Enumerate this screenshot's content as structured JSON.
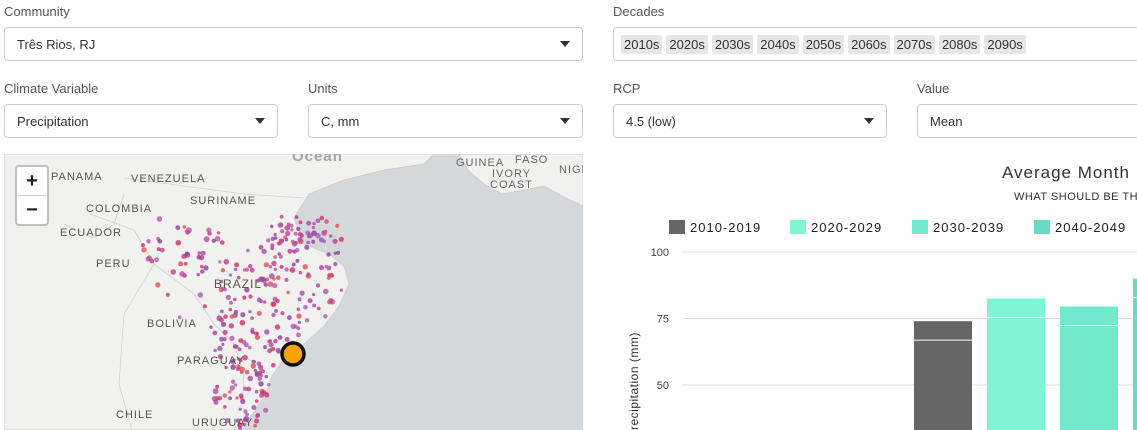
{
  "controls": {
    "community": {
      "label": "Community",
      "value": "Três Rios, RJ"
    },
    "decades": {
      "label": "Decades",
      "chips": [
        "2010s",
        "2020s",
        "2030s",
        "2040s",
        "2050s",
        "2060s",
        "2070s",
        "2080s",
        "2090s"
      ]
    },
    "climate_variable": {
      "label": "Climate Variable",
      "value": "Precipitation"
    },
    "units": {
      "label": "Units",
      "value": "C, mm"
    },
    "rcp": {
      "label": "RCP",
      "value": "4.5 (low)"
    },
    "value": {
      "label": "Value",
      "value": "Mean"
    }
  },
  "map": {
    "zoom_in": "+",
    "zoom_out": "−",
    "labels": [
      "Ocean",
      "GUINEA",
      "FASO",
      "IVORY",
      "COAST",
      "NIGE",
      "PANAMA",
      "VENEZUELA",
      "COLOMBIA",
      "SURINAME",
      "ECUADOR",
      "PERU",
      "BRAZIL",
      "BOLIVIA",
      "PARAGUAY",
      "CHILE",
      "URUGUAY"
    ],
    "selected_color": "#f5a300"
  },
  "chart_data": {
    "type": "bar",
    "title": "Average Month",
    "subtitle": "WHAT SHOULD BE TH",
    "ylabel": "recipitation (mm)",
    "yticks": [
      50,
      75,
      100
    ],
    "ylim": [
      50,
      100
    ],
    "series": [
      {
        "name": "2010-2019",
        "color": "#666666",
        "value": 74
      },
      {
        "name": "2020-2029",
        "color": "#7ff5d5",
        "value": 82.5
      },
      {
        "name": "2030-2039",
        "color": "#72e8cc",
        "value": 79.5
      },
      {
        "name": "2040-2049",
        "color": "#69dbc4",
        "value": 90
      }
    ]
  }
}
